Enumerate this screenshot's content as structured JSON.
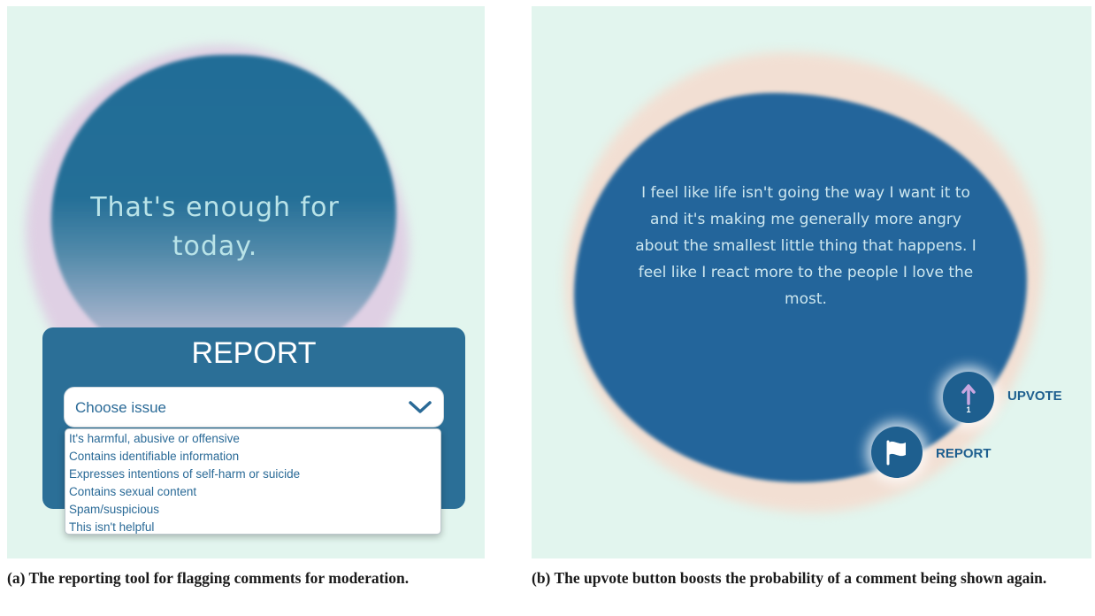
{
  "panel_a": {
    "prompt": "That's enough for today.",
    "report_title": "REPORT",
    "select_label": "Choose issue",
    "options": [
      "It's harmful, abusive or offensive",
      "Contains identifiable information",
      "Expresses intentions of self-harm or suicide",
      "Contains sexual content",
      "Spam/suspicious",
      "This isn't helpful"
    ]
  },
  "panel_b": {
    "comment": "I feel like life isn't going the way I want it to and it's making me generally more angry about the smallest little thing that happens. I feel like I react more to the people I love the most.",
    "upvote_label": "UPVOTE",
    "upvote_count": "1",
    "report_label": "REPORT"
  },
  "captions": {
    "a": "(a) The reporting tool for flagging comments for moderation.",
    "b": "(b) The upvote button boosts the probability of a comment being shown again."
  },
  "colors": {
    "background": "#e2f5ee",
    "blob_blue": "#23659b",
    "accent_lilac": "#c9a7e0"
  },
  "icons": [
    "chevron-down-icon",
    "arrow-up-icon",
    "flag-icon"
  ]
}
